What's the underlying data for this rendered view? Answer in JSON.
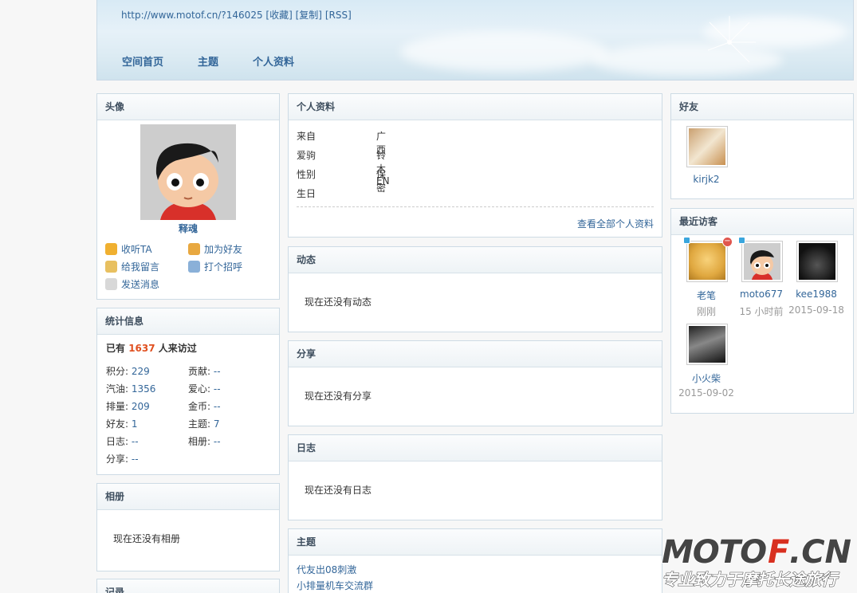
{
  "header": {
    "title": "",
    "url": "http://www.motof.cn/?146025",
    "links": [
      "[收藏]",
      "[复制]",
      "[RSS]"
    ],
    "nav": [
      "空间首页",
      "主题",
      "个人资料"
    ]
  },
  "avatar_box": {
    "title": "头像",
    "name": "释魂",
    "actions": [
      "收听TA",
      "加为好友",
      "给我留言",
      "打个招呼",
      "发送消息"
    ]
  },
  "stats_box": {
    "title": "统计信息",
    "visit_prefix": "已有",
    "visit_count": "1637",
    "visit_suffix": "人来访过",
    "items": [
      {
        "label": "积分:",
        "value": "229"
      },
      {
        "label": "贡献:",
        "value": "--"
      },
      {
        "label": "汽油:",
        "value": "1356"
      },
      {
        "label": "爱心:",
        "value": "--"
      },
      {
        "label": "排量:",
        "value": "209"
      },
      {
        "label": "金币:",
        "value": "--"
      },
      {
        "label": "好友:",
        "value": "1"
      },
      {
        "label": "主题:",
        "value": "7"
      },
      {
        "label": "日志:",
        "value": "--"
      },
      {
        "label": "相册:",
        "value": "--"
      },
      {
        "label": "分享:",
        "value": "--"
      }
    ]
  },
  "album_box": {
    "title": "相册",
    "empty": "现在还没有相册"
  },
  "record_box": {
    "title": "记录"
  },
  "profile_box": {
    "title": "个人资料",
    "rows": [
      {
        "label": "来自",
        "value": "广西"
      },
      {
        "label": "爱驹",
        "value": "铃木EN"
      },
      {
        "label": "性别",
        "value": "保密"
      },
      {
        "label": "生日",
        "value": ""
      }
    ],
    "more": "查看全部个人资料"
  },
  "feed_box": {
    "title": "动态",
    "empty": "现在还没有动态"
  },
  "share_box": {
    "title": "分享",
    "empty": "现在还没有分享"
  },
  "blog_box": {
    "title": "日志",
    "empty": "现在还没有日志"
  },
  "topic_box": {
    "title": "主题",
    "items": [
      "代友出08刺激",
      "小排量机车交流群"
    ]
  },
  "friends_box": {
    "title": "好友",
    "items": [
      {
        "name": "kirjk2"
      }
    ]
  },
  "visitors_box": {
    "title": "最近访客",
    "items": [
      {
        "name": "老笔",
        "time": "刚刚"
      },
      {
        "name": "moto677",
        "time": "15 小时前"
      },
      {
        "name": "kee1988",
        "time": "2015-09-18"
      },
      {
        "name": "小火柴",
        "time": "2015-09-02"
      }
    ]
  },
  "watermark": {
    "brand": "MOTOF.CN",
    "slogan": "专业致力于摩托长途旅行"
  },
  "colors": {
    "link": "#336699",
    "accent": "#e05020",
    "border": "#cddbe5"
  }
}
